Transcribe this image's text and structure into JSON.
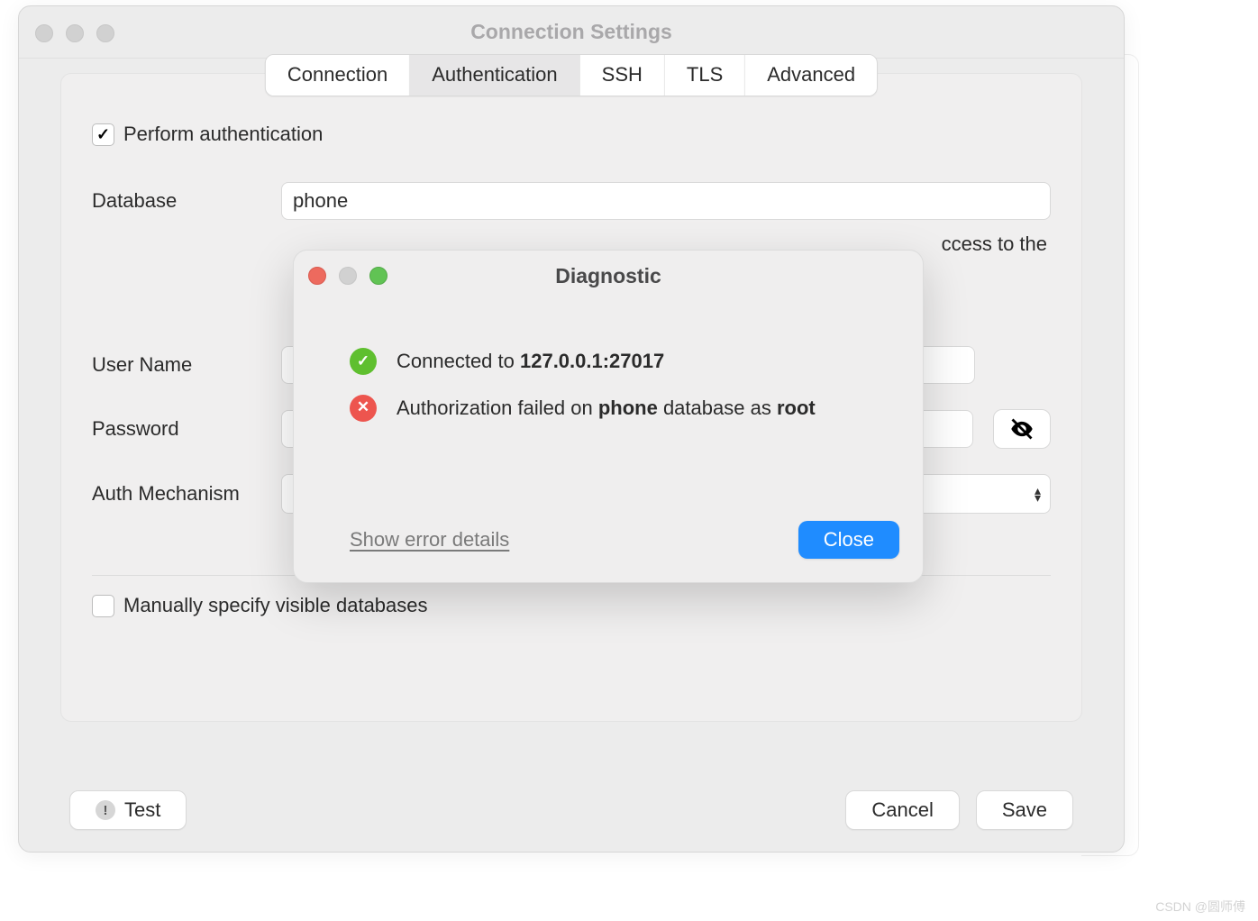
{
  "window": {
    "title": "Connection Settings"
  },
  "tabs": [
    {
      "label": "Connection"
    },
    {
      "label": "Authentication"
    },
    {
      "label": "SSH"
    },
    {
      "label": "TLS"
    },
    {
      "label": "Advanced"
    }
  ],
  "form": {
    "perform_auth_label": "Perform authentication",
    "database_label": "Database",
    "database_value": "phone",
    "helper_tail": "ccess to the",
    "username_label": "User Name",
    "password_label": "Password",
    "auth_mech_label": "Auth Mechanism",
    "manual_label": "Manually specify visible databases"
  },
  "footer": {
    "test": "Test",
    "cancel": "Cancel",
    "save": "Save"
  },
  "dialog": {
    "title": "Diagnostic",
    "connected_prefix": "Connected to ",
    "connected_host": "127.0.0.1:27017",
    "auth_line_p1": "Authorization failed on ",
    "auth_line_db": "phone",
    "auth_line_p2": " database as ",
    "auth_line_user": "root",
    "details": "Show error details",
    "close": "Close"
  },
  "watermark": "CSDN @圆师傅"
}
